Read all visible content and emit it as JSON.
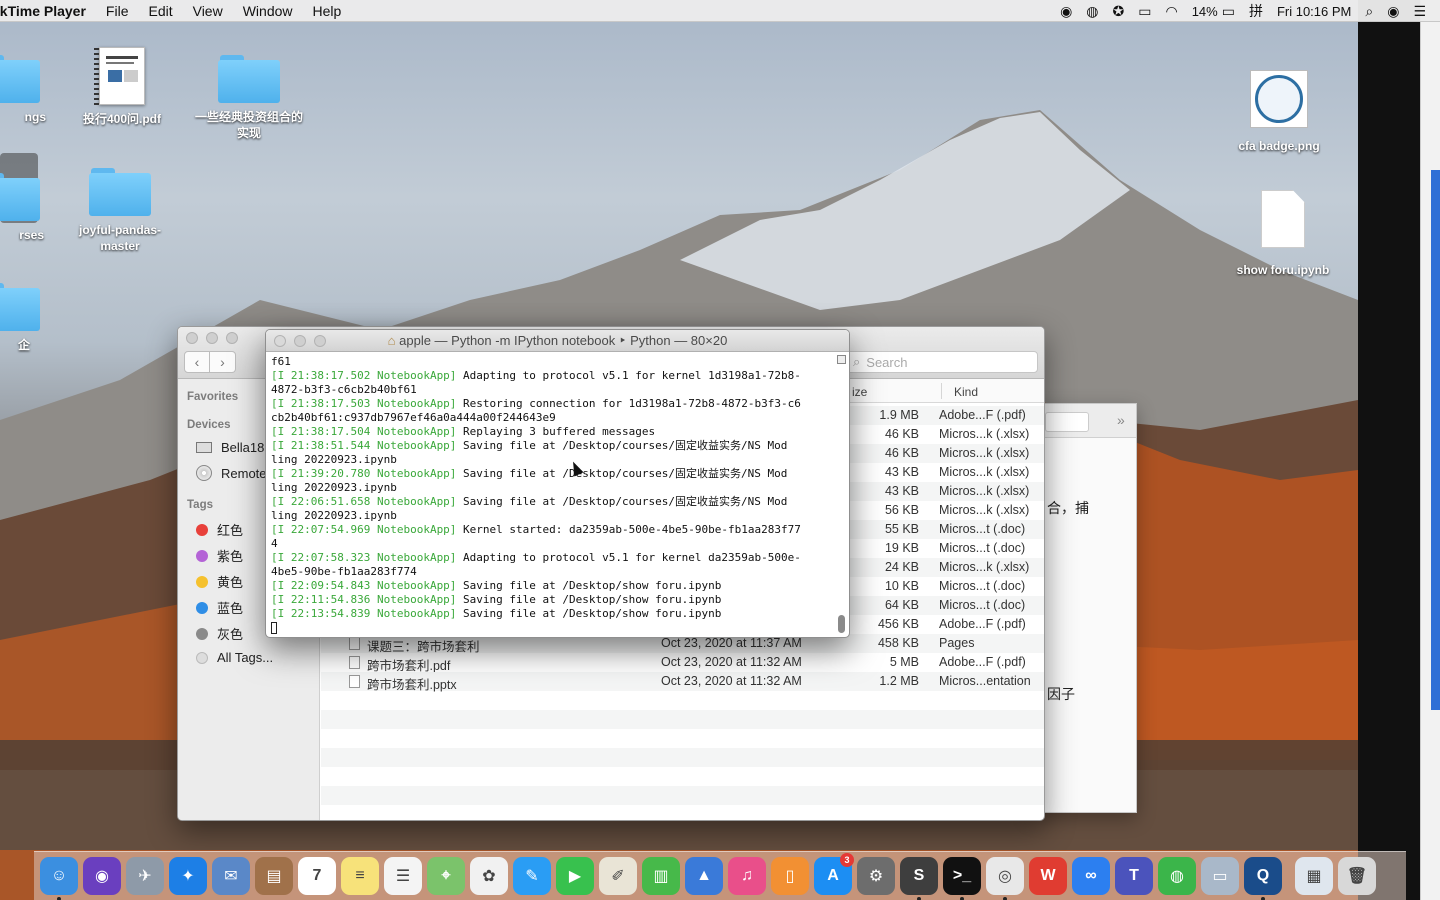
{
  "menubar": {
    "app_name": "ckTime Player",
    "menus": [
      "File",
      "Edit",
      "View",
      "Window",
      "Help"
    ],
    "battery": "14%",
    "clock": "Fri 10:16 PM"
  },
  "desktop": {
    "icons": [
      {
        "label": "ngs",
        "kind": "folder"
      },
      {
        "label": "投行400问.pdf",
        "kind": "pdf"
      },
      {
        "label": "一些经典投资组合的实现",
        "kind": "folder"
      },
      {
        "label": "rses",
        "kind": "folder"
      },
      {
        "label": "joyful-pandas-master",
        "kind": "folder"
      },
      {
        "label": "企",
        "kind": "folder"
      },
      {
        "label": "cfa badge.png",
        "kind": "image"
      },
      {
        "label": "show foru.ipynb",
        "kind": "document"
      }
    ]
  },
  "finder": {
    "search_placeholder": "Search",
    "sidebar": {
      "favorites_heading": "Favorites",
      "devices_heading": "Devices",
      "devices": [
        "Bella18",
        "Remote"
      ],
      "tags_heading": "Tags",
      "tags": [
        {
          "label": "红色",
          "color": "#e8403a"
        },
        {
          "label": "紫色",
          "color": "#b463d6"
        },
        {
          "label": "黄色",
          "color": "#f5c12e"
        },
        {
          "label": "蓝色",
          "color": "#2f8ee6"
        },
        {
          "label": "灰色",
          "color": "#8a8a8a"
        },
        {
          "label": "All Tags...",
          "color": "#dddddd"
        }
      ]
    },
    "columns": {
      "size": "ize",
      "kind": "Kind"
    },
    "rows": [
      {
        "name": "",
        "date": "",
        "size": "1.9 MB",
        "kind": "Adobe...F (.pdf)"
      },
      {
        "name": "",
        "date": "",
        "size": "46 KB",
        "kind": "Micros...k (.xlsx)"
      },
      {
        "name": "",
        "date": "",
        "size": "46 KB",
        "kind": "Micros...k (.xlsx)"
      },
      {
        "name": "",
        "date": "",
        "size": "43 KB",
        "kind": "Micros...k (.xlsx)"
      },
      {
        "name": "",
        "date": "",
        "size": "43 KB",
        "kind": "Micros...k (.xlsx)"
      },
      {
        "name": "",
        "date": "",
        "size": "56 KB",
        "kind": "Micros...k (.xlsx)"
      },
      {
        "name": "",
        "date": "",
        "size": "55 KB",
        "kind": "Micros...t (.doc)"
      },
      {
        "name": "",
        "date": "",
        "size": "19 KB",
        "kind": "Micros...t (.doc)"
      },
      {
        "name": "",
        "date": "",
        "size": "24 KB",
        "kind": "Micros...k (.xlsx)"
      },
      {
        "name": "",
        "date": "",
        "size": "10 KB",
        "kind": "Micros...t (.doc)"
      },
      {
        "name": "",
        "date": "",
        "size": "64 KB",
        "kind": "Micros...t (.doc)"
      },
      {
        "name": "",
        "date": "",
        "size": "456 KB",
        "kind": "Adobe...F (.pdf)"
      },
      {
        "name": "课题三：跨市场套利",
        "date": "Oct 23, 2020 at 11:37 AM",
        "size": "458 KB",
        "kind": "Pages"
      },
      {
        "name": "跨市场套利.pdf",
        "date": "Oct 23, 2020 at 11:32 AM",
        "size": "5 MB",
        "kind": "Adobe...F (.pdf)"
      },
      {
        "name": "跨市场套利.pptx",
        "date": "Oct 23, 2020 at 11:32 AM",
        "size": "1.2 MB",
        "kind": "Micros...entation"
      }
    ]
  },
  "background_window": {
    "line1": "合，捕",
    "line2": "因子"
  },
  "terminal": {
    "title": "apple — Python -m IPython notebook ‣ Python — 80×20",
    "lines": [
      {
        "prefix": "",
        "text": "f61"
      },
      {
        "prefix": "[I 21:38:17.502 NotebookApp]",
        "text": " Adapting to protocol v5.1 for kernel 1d3198a1-72b8-"
      },
      {
        "prefix": "",
        "text": "4872-b3f3-c6cb2b40bf61"
      },
      {
        "prefix": "[I 21:38:17.503 NotebookApp]",
        "text": " Restoring connection for 1d3198a1-72b8-4872-b3f3-c6"
      },
      {
        "prefix": "",
        "text": "cb2b40bf61:c937db7967ef46a0a444a00f244643e9"
      },
      {
        "prefix": "[I 21:38:17.504 NotebookApp]",
        "text": " Replaying 3 buffered messages"
      },
      {
        "prefix": "[I 21:38:51.544 NotebookApp]",
        "text": " Saving file at /Desktop/courses/固定收益实务/NS Mod"
      },
      {
        "prefix": "",
        "text": "ling 20220923.ipynb"
      },
      {
        "prefix": "[I 21:39:20.780 NotebookApp]",
        "text": " Saving file at /Desktop/courses/固定收益实务/NS Mod"
      },
      {
        "prefix": "",
        "text": "ling 20220923.ipynb"
      },
      {
        "prefix": "[I 22:06:51.658 NotebookApp]",
        "text": " Saving file at /Desktop/courses/固定收益实务/NS Mod"
      },
      {
        "prefix": "",
        "text": "ling 20220923.ipynb"
      },
      {
        "prefix": "[I 22:07:54.969 NotebookApp]",
        "text": " Kernel started: da2359ab-500e-4be5-90be-fb1aa283f77"
      },
      {
        "prefix": "",
        "text": "4"
      },
      {
        "prefix": "[I 22:07:58.323 NotebookApp]",
        "text": " Adapting to protocol v5.1 for kernel da2359ab-500e-"
      },
      {
        "prefix": "",
        "text": "4be5-90be-fb1aa283f774"
      },
      {
        "prefix": "[I 22:09:54.843 NotebookApp]",
        "text": " Saving file at /Desktop/show foru.ipynb"
      },
      {
        "prefix": "[I 22:11:54.836 NotebookApp]",
        "text": " Saving file at /Desktop/show foru.ipynb"
      },
      {
        "prefix": "[I 22:13:54.839 NotebookApp]",
        "text": " Saving file at /Desktop/show foru.ipynb"
      }
    ]
  },
  "dock": {
    "apps": [
      {
        "icon": "finder-icon",
        "color": "#3b8fe0",
        "glyph": "☺"
      },
      {
        "icon": "siri-icon",
        "color": "#6a3fbf",
        "glyph": "◉"
      },
      {
        "icon": "launchpad-icon",
        "color": "#8e9aa8",
        "glyph": "✈"
      },
      {
        "icon": "safari-icon",
        "color": "#1d7fe6",
        "glyph": "✦"
      },
      {
        "icon": "mail-stamp-icon",
        "color": "#5a88c8",
        "glyph": "✉"
      },
      {
        "icon": "contacts-icon",
        "color": "#a0714a",
        "glyph": "▤"
      },
      {
        "icon": "calendar-icon",
        "color": "#ffffff",
        "glyph": "7"
      },
      {
        "icon": "notes-icon",
        "color": "#f7e27a",
        "glyph": "≡"
      },
      {
        "icon": "reminders-icon",
        "color": "#f4f4f4",
        "glyph": "☰"
      },
      {
        "icon": "maps-icon",
        "color": "#7bc36b",
        "glyph": "⌖"
      },
      {
        "icon": "photos-icon",
        "color": "#f1f1f1",
        "glyph": "✿"
      },
      {
        "icon": "messages-icon",
        "color": "#2a9df4",
        "glyph": "✎"
      },
      {
        "icon": "facetime-icon",
        "color": "#38c14e",
        "glyph": "▶"
      },
      {
        "icon": "keynote-draw-icon",
        "color": "#e9e4d6",
        "glyph": "✐"
      },
      {
        "icon": "numbers-icon",
        "color": "#47b94a",
        "glyph": "▥"
      },
      {
        "icon": "keynote-icon",
        "color": "#3a7ad9",
        "glyph": "▲"
      },
      {
        "icon": "itunes-icon",
        "color": "#e94f8a",
        "glyph": "♫"
      },
      {
        "icon": "books-icon",
        "color": "#f29033",
        "glyph": "▯"
      },
      {
        "icon": "app-store-icon",
        "color": "#1c8ef3",
        "glyph": "A",
        "badge": "3"
      },
      {
        "icon": "system-preferences-icon",
        "color": "#6d6d6d",
        "glyph": "⚙"
      },
      {
        "icon": "sublime-icon",
        "color": "#3e3e3e",
        "glyph": "S"
      },
      {
        "icon": "terminal-icon",
        "color": "#111111",
        "glyph": ">_"
      },
      {
        "icon": "chrome-icon",
        "color": "#e8e8e8",
        "glyph": "◎"
      },
      {
        "icon": "wps-icon",
        "color": "#e03c31",
        "glyph": "W"
      },
      {
        "icon": "baidu-netdisk-icon",
        "color": "#2c7ff0",
        "glyph": "∞"
      },
      {
        "icon": "teams-icon",
        "color": "#4b53bc",
        "glyph": "T"
      },
      {
        "icon": "wechat-icon",
        "color": "#3bb54a",
        "glyph": "◍"
      },
      {
        "icon": "preview-icon",
        "color": "#a9b8c9",
        "glyph": "▭"
      },
      {
        "icon": "quicktime-icon",
        "color": "#1a4c8a",
        "glyph": "Q"
      },
      {
        "icon": "downloads-stack-icon",
        "color": "#dfe6ee",
        "glyph": "▦"
      },
      {
        "icon": "trash-icon",
        "color": "#d8d8d8",
        "glyph": "🗑"
      }
    ]
  }
}
